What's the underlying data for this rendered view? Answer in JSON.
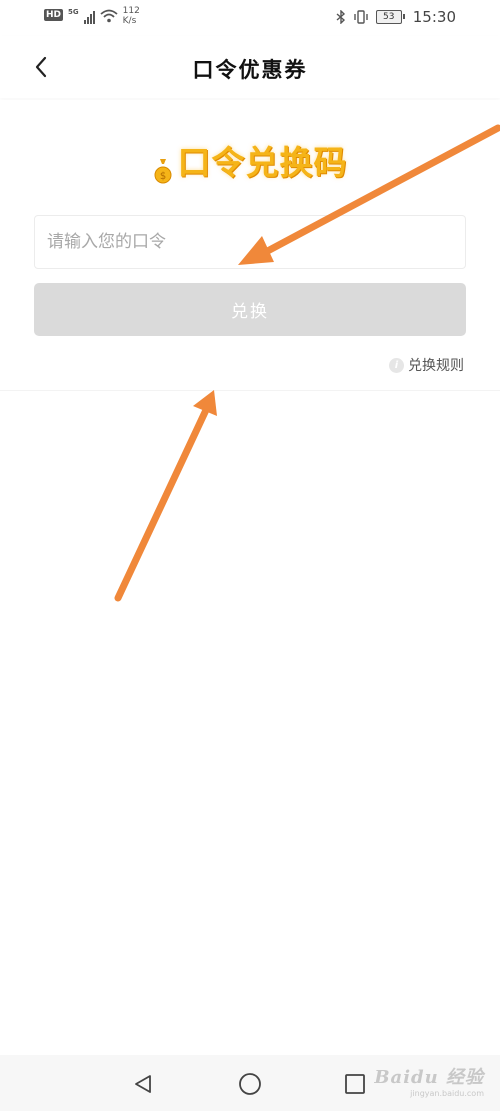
{
  "status_bar": {
    "hd": "HD",
    "signal_type": "5G",
    "net_speed_value": "112",
    "net_speed_unit": "K/s",
    "battery_level": "53",
    "time": "15:30"
  },
  "header": {
    "title": "口令优惠券",
    "back_icon": "chevron-left-icon"
  },
  "banner": {
    "title": "口令兑换码",
    "icon": "money-bag-icon"
  },
  "form": {
    "input_value": "",
    "input_placeholder": "请输入您的口令",
    "redeem_label": "兑换",
    "rules_label": "兑换规则",
    "info_icon": "i"
  },
  "colors": {
    "banner_gold": "#f5b418",
    "button_disabled": "#dadada",
    "annotation_arrow": "#f0883a"
  },
  "nav_bar": {
    "back_icon": "triangle-back-icon",
    "home_icon": "circle-home-icon",
    "recent_icon": "square-recent-icon"
  },
  "watermark": {
    "logo": "Baidu 经验",
    "sub": "jingyan.baidu.com"
  }
}
